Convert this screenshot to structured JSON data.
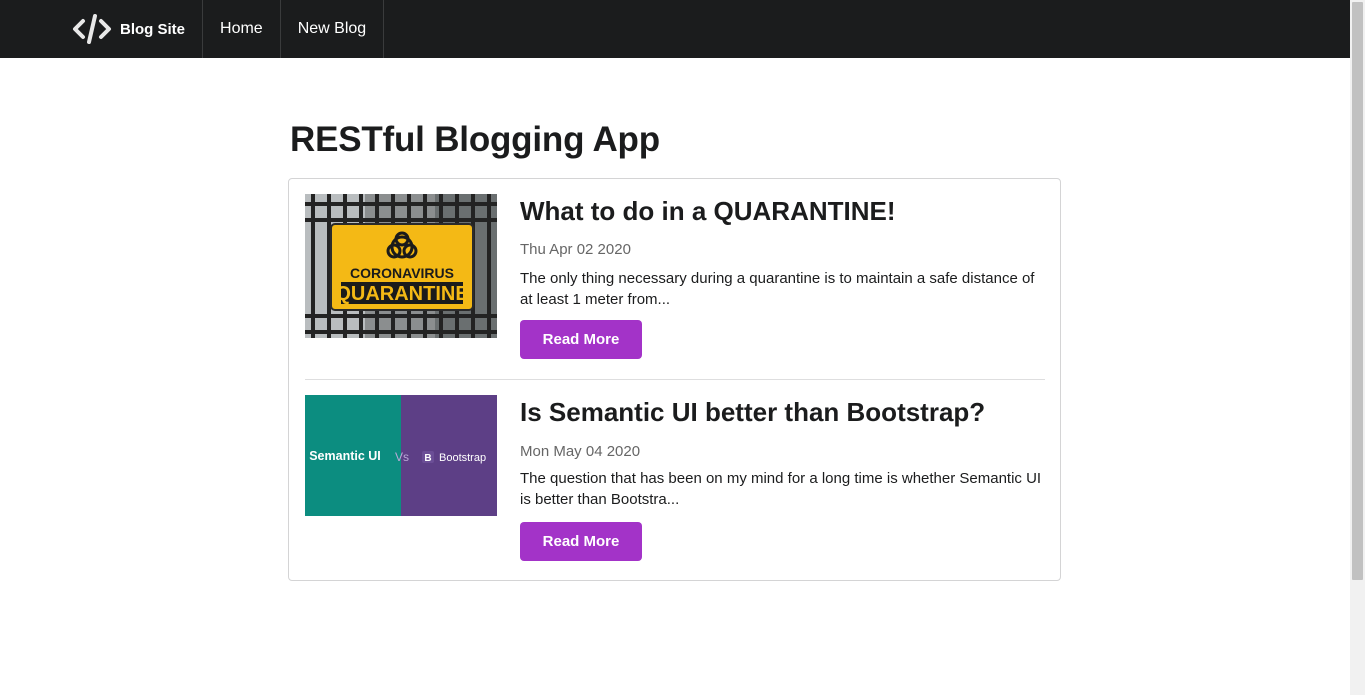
{
  "nav": {
    "brand": "Blog Site",
    "items": [
      {
        "label": "Home"
      },
      {
        "label": "New Blog"
      }
    ]
  },
  "page": {
    "title": "RESTful Blogging App"
  },
  "posts": [
    {
      "title": "What to do in a QUARANTINE!",
      "date": "Thu Apr 02 2020",
      "excerpt": "The only thing necessary during a quarantine is to maintain a safe distance of at least 1 meter from...",
      "button": "Read More",
      "image_text": [
        "CORONAVIRUS",
        "QUARANTINE"
      ]
    },
    {
      "title": "Is Semantic UI better than Bootstrap?",
      "date": "Mon May 04 2020",
      "excerpt": "The question that has been on my mind for a long time is whether Semantic UI is better than Bootstra...",
      "button": "Read More",
      "image_text": [
        "Semantic UI",
        "Vs",
        "B",
        "Bootstrap"
      ]
    }
  ],
  "colors": {
    "navbar": "#1b1c1d",
    "button": "#a333c8",
    "semantic_teal": "#0c8d80",
    "bootstrap_purple": "#5d3f86",
    "sign_yellow": "#f4b915"
  }
}
